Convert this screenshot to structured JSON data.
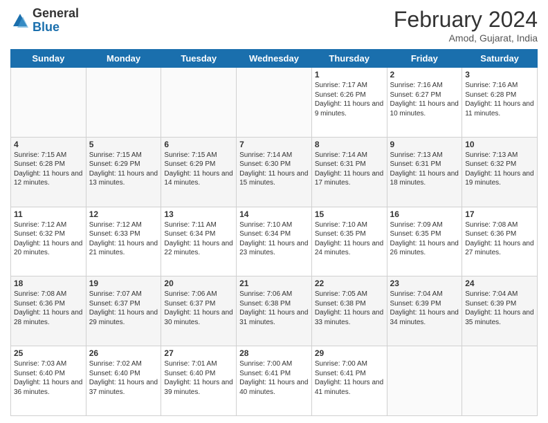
{
  "logo": {
    "general": "General",
    "blue": "Blue"
  },
  "header": {
    "title": "February 2024",
    "subtitle": "Amod, Gujarat, India"
  },
  "days": [
    "Sunday",
    "Monday",
    "Tuesday",
    "Wednesday",
    "Thursday",
    "Friday",
    "Saturday"
  ],
  "weeks": [
    [
      {
        "day": "",
        "info": ""
      },
      {
        "day": "",
        "info": ""
      },
      {
        "day": "",
        "info": ""
      },
      {
        "day": "",
        "info": ""
      },
      {
        "day": "1",
        "info": "Sunrise: 7:17 AM\nSunset: 6:26 PM\nDaylight: 11 hours and 9 minutes."
      },
      {
        "day": "2",
        "info": "Sunrise: 7:16 AM\nSunset: 6:27 PM\nDaylight: 11 hours and 10 minutes."
      },
      {
        "day": "3",
        "info": "Sunrise: 7:16 AM\nSunset: 6:28 PM\nDaylight: 11 hours and 11 minutes."
      }
    ],
    [
      {
        "day": "4",
        "info": "Sunrise: 7:15 AM\nSunset: 6:28 PM\nDaylight: 11 hours and 12 minutes."
      },
      {
        "day": "5",
        "info": "Sunrise: 7:15 AM\nSunset: 6:29 PM\nDaylight: 11 hours and 13 minutes."
      },
      {
        "day": "6",
        "info": "Sunrise: 7:15 AM\nSunset: 6:29 PM\nDaylight: 11 hours and 14 minutes."
      },
      {
        "day": "7",
        "info": "Sunrise: 7:14 AM\nSunset: 6:30 PM\nDaylight: 11 hours and 15 minutes."
      },
      {
        "day": "8",
        "info": "Sunrise: 7:14 AM\nSunset: 6:31 PM\nDaylight: 11 hours and 17 minutes."
      },
      {
        "day": "9",
        "info": "Sunrise: 7:13 AM\nSunset: 6:31 PM\nDaylight: 11 hours and 18 minutes."
      },
      {
        "day": "10",
        "info": "Sunrise: 7:13 AM\nSunset: 6:32 PM\nDaylight: 11 hours and 19 minutes."
      }
    ],
    [
      {
        "day": "11",
        "info": "Sunrise: 7:12 AM\nSunset: 6:32 PM\nDaylight: 11 hours and 20 minutes."
      },
      {
        "day": "12",
        "info": "Sunrise: 7:12 AM\nSunset: 6:33 PM\nDaylight: 11 hours and 21 minutes."
      },
      {
        "day": "13",
        "info": "Sunrise: 7:11 AM\nSunset: 6:34 PM\nDaylight: 11 hours and 22 minutes."
      },
      {
        "day": "14",
        "info": "Sunrise: 7:10 AM\nSunset: 6:34 PM\nDaylight: 11 hours and 23 minutes."
      },
      {
        "day": "15",
        "info": "Sunrise: 7:10 AM\nSunset: 6:35 PM\nDaylight: 11 hours and 24 minutes."
      },
      {
        "day": "16",
        "info": "Sunrise: 7:09 AM\nSunset: 6:35 PM\nDaylight: 11 hours and 26 minutes."
      },
      {
        "day": "17",
        "info": "Sunrise: 7:08 AM\nSunset: 6:36 PM\nDaylight: 11 hours and 27 minutes."
      }
    ],
    [
      {
        "day": "18",
        "info": "Sunrise: 7:08 AM\nSunset: 6:36 PM\nDaylight: 11 hours and 28 minutes."
      },
      {
        "day": "19",
        "info": "Sunrise: 7:07 AM\nSunset: 6:37 PM\nDaylight: 11 hours and 29 minutes."
      },
      {
        "day": "20",
        "info": "Sunrise: 7:06 AM\nSunset: 6:37 PM\nDaylight: 11 hours and 30 minutes."
      },
      {
        "day": "21",
        "info": "Sunrise: 7:06 AM\nSunset: 6:38 PM\nDaylight: 11 hours and 31 minutes."
      },
      {
        "day": "22",
        "info": "Sunrise: 7:05 AM\nSunset: 6:38 PM\nDaylight: 11 hours and 33 minutes."
      },
      {
        "day": "23",
        "info": "Sunrise: 7:04 AM\nSunset: 6:39 PM\nDaylight: 11 hours and 34 minutes."
      },
      {
        "day": "24",
        "info": "Sunrise: 7:04 AM\nSunset: 6:39 PM\nDaylight: 11 hours and 35 minutes."
      }
    ],
    [
      {
        "day": "25",
        "info": "Sunrise: 7:03 AM\nSunset: 6:40 PM\nDaylight: 11 hours and 36 minutes."
      },
      {
        "day": "26",
        "info": "Sunrise: 7:02 AM\nSunset: 6:40 PM\nDaylight: 11 hours and 37 minutes."
      },
      {
        "day": "27",
        "info": "Sunrise: 7:01 AM\nSunset: 6:40 PM\nDaylight: 11 hours and 39 minutes."
      },
      {
        "day": "28",
        "info": "Sunrise: 7:00 AM\nSunset: 6:41 PM\nDaylight: 11 hours and 40 minutes."
      },
      {
        "day": "29",
        "info": "Sunrise: 7:00 AM\nSunset: 6:41 PM\nDaylight: 11 hours and 41 minutes."
      },
      {
        "day": "",
        "info": ""
      },
      {
        "day": "",
        "info": ""
      }
    ]
  ]
}
